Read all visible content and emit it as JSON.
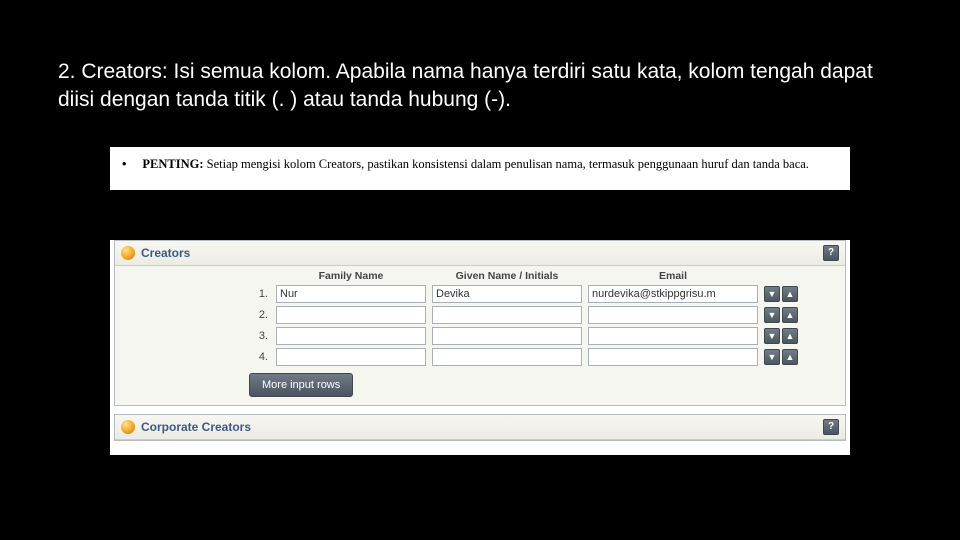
{
  "heading": "2. Creators: Isi semua kolom. Apabila nama hanya terdiri satu kata, kolom tengah dapat diisi dengan tanda titik (. ) atau tanda hubung (-).",
  "note": {
    "prefix": "PENTING:",
    "text": " Setiap mengisi kolom Creators, pastikan konsistensi dalam penulisan nama, termasuk penggunaan huruf dan tanda baca."
  },
  "sections": {
    "creators": {
      "title": "Creators",
      "help": "?",
      "headers": {
        "family": "Family Name",
        "given": "Given Name / Initials",
        "email": "Email"
      },
      "rows": [
        {
          "num": "1.",
          "family": "Nur",
          "given": "Devika",
          "email": "nurdevika@stkippgrisu.m"
        },
        {
          "num": "2.",
          "family": "",
          "given": "",
          "email": ""
        },
        {
          "num": "3.",
          "family": "",
          "given": "",
          "email": ""
        },
        {
          "num": "4.",
          "family": "",
          "given": "",
          "email": ""
        }
      ],
      "more_label": "More input rows"
    },
    "corporate": {
      "title": "Corporate Creators",
      "help": "?"
    }
  },
  "arrows": {
    "down": "▼",
    "up": "▲"
  }
}
